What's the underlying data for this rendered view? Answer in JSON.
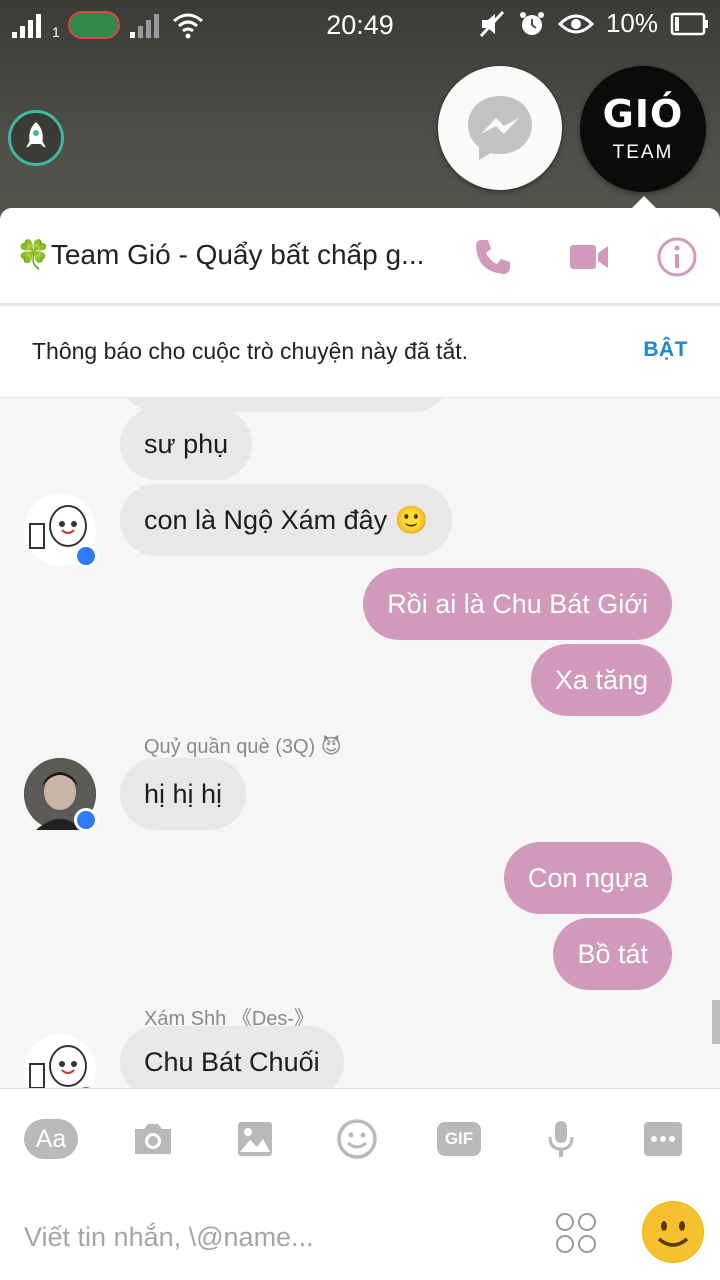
{
  "status_bar": {
    "time": "20:49",
    "battery": "10%",
    "sim_indicator": "1",
    "icons": [
      "signal-icon",
      "carrier-icon",
      "signal-weak-icon",
      "wifi-icon",
      "mute-icon",
      "alarm-icon",
      "eye-icon",
      "battery-icon"
    ]
  },
  "chat_heads": {
    "team_logo": "GIÓ",
    "team_label": "TEAM"
  },
  "header": {
    "title": "🍀Team Gió - Quẩy bất chấp g...",
    "accent_color": "#d19abd"
  },
  "notice": {
    "text": "Thông báo cho cuộc trò chuyện này đã tắt.",
    "action": "BẬT"
  },
  "messages": [
    {
      "direction": "in",
      "text": "sư phụ"
    },
    {
      "direction": "in",
      "text": "con là Ngộ Xám đây 🙂"
    },
    {
      "direction": "out",
      "text": "Rồi ai là Chu Bát Giới"
    },
    {
      "direction": "out",
      "text": "Xa tăng"
    },
    {
      "direction": "in",
      "sender": "Quỷ quần què (3Q) 😈",
      "text": "hị hị hị"
    },
    {
      "direction": "out",
      "text": "Con ngựa"
    },
    {
      "direction": "out",
      "text": "Bồ tát"
    },
    {
      "direction": "in",
      "sender": "Xám Shh 《Des-》",
      "text": "Chu Bát Chuối"
    }
  ],
  "composer": {
    "aa_label": "Aa",
    "gif_label": "GIF",
    "placeholder": "Viết tin nhắn, \\@name..."
  }
}
